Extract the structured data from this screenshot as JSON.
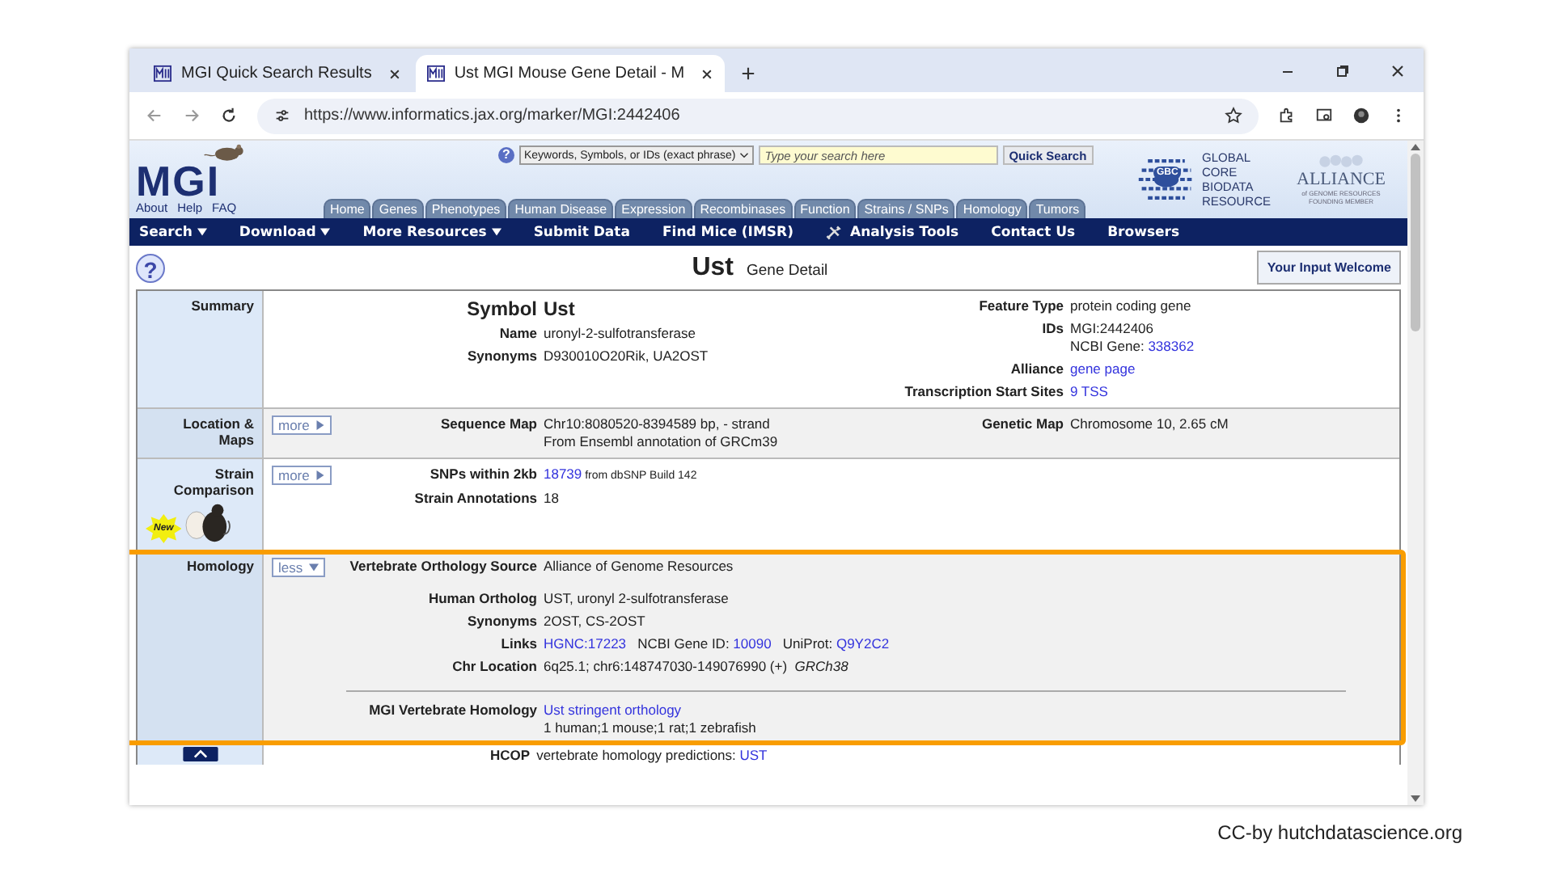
{
  "browser": {
    "tabs": [
      {
        "title": "MGI Quick Search Results",
        "selected": false
      },
      {
        "title": "Ust MGI Mouse Gene Detail - M",
        "selected": true
      }
    ],
    "url": "https://www.informatics.jax.org/marker/MGI:2442406"
  },
  "header": {
    "logo": "MGI",
    "logo_links": [
      "About",
      "Help",
      "FAQ"
    ],
    "help": "?",
    "search_scope": "Keywords, Symbols, or IDs (exact phrase)",
    "search": {
      "placeholder": "Type your search here"
    },
    "search_button": "Quick Search",
    "gcbr_badge": "GBC",
    "gcbr": "GLOBAL CORE BIODATA RESOURCE",
    "alliance": "ALLIANCE",
    "alliance_sub": "of GENOME RESOURCES",
    "alliance_member": "FOUNDING MEMBER",
    "tabs": [
      "Home",
      "Genes",
      "Phenotypes",
      "Human Disease",
      "Expression",
      "Recombinases",
      "Function",
      "Strains / SNPs",
      "Homology",
      "Tumors"
    ]
  },
  "nav": [
    {
      "label": "Search",
      "kind": "menu"
    },
    {
      "label": "Download",
      "kind": "menu"
    },
    {
      "label": "More Resources",
      "kind": "menu"
    },
    {
      "label": "Submit Data",
      "kind": "link"
    },
    {
      "label": "Find Mice (IMSR)",
      "kind": "link"
    },
    {
      "label": "Analysis Tools",
      "kind": "tools"
    },
    {
      "label": "Contact Us",
      "kind": "link"
    },
    {
      "label": "Browsers",
      "kind": "link"
    }
  ],
  "title": {
    "help": "?",
    "symbol": "Ust",
    "subtitle": "Gene Detail",
    "feedback_button": "Your Input Welcome"
  },
  "sections": [
    {
      "label": "Summary",
      "shaded": false,
      "highlighted": false,
      "columns": [
        [
          {
            "fields": [
              {
                "kind": "symbol",
                "label": "Symbol",
                "lines": [
                  [
                    {
                      "text": "Ust"
                    }
                  ]
                ]
              },
              {
                "kind": "field",
                "label": "Name",
                "lines": [
                  [
                    {
                      "text": "uronyl-2-sulfotransferase"
                    }
                  ]
                ]
              },
              {
                "kind": "field",
                "label": "Synonyms",
                "lines": [
                  [
                    {
                      "text": "D930010O20Rik, UA2OST"
                    }
                  ]
                ]
              }
            ]
          }
        ],
        [
          {
            "fields": [
              {
                "kind": "field",
                "label": "Feature Type",
                "lines": [
                  [
                    {
                      "text": "protein coding gene"
                    }
                  ]
                ]
              },
              {
                "kind": "field",
                "label": "IDs",
                "lines": [
                  [
                    {
                      "text": "MGI:2442406"
                    }
                  ],
                  [
                    {
                      "text": "NCBI Gene: "
                    },
                    {
                      "text": "338362",
                      "kind": "link"
                    }
                  ]
                ]
              },
              {
                "kind": "field",
                "label": "Alliance",
                "lines": [
                  [
                    {
                      "text": "gene page",
                      "kind": "link"
                    }
                  ]
                ]
              },
              {
                "kind": "field",
                "label": "Transcription Start Sites",
                "lines": [
                  [
                    {
                      "text": "9 TSS",
                      "kind": "link"
                    }
                  ]
                ]
              }
            ]
          }
        ]
      ]
    },
    {
      "label": "Location & Maps",
      "shaded": true,
      "highlighted": false,
      "expander": {
        "text": "more",
        "expanded": false
      },
      "columns": [
        [
          {
            "fields": [
              {
                "kind": "field",
                "label": "Sequence Map",
                "lines": [
                  [
                    {
                      "text": "Chr10:8080520-8394589 bp, - strand"
                    }
                  ],
                  [
                    {
                      "text": "From Ensembl annotation of GRCm39"
                    }
                  ]
                ]
              }
            ]
          }
        ],
        [
          {
            "fields": [
              {
                "kind": "field",
                "label": "Genetic Map",
                "lines": [
                  [
                    {
                      "text": "Chromosome 10, 2.65 cM"
                    }
                  ]
                ]
              }
            ]
          }
        ]
      ]
    },
    {
      "label": "Strain Comparison",
      "shaded": false,
      "highlighted": false,
      "badge": "New",
      "expander": {
        "text": "more",
        "expanded": false
      },
      "columns": [
        [
          {
            "fields": [
              {
                "kind": "field",
                "label": "SNPs within 2kb",
                "lines": [
                  [
                    {
                      "text": "18739",
                      "kind": "link"
                    },
                    {
                      "text": " from dbSNP Build 142",
                      "kind": "small"
                    }
                  ]
                ]
              },
              {
                "kind": "field",
                "label": "Strain Annotations",
                "lines": [
                  [
                    {
                      "text": "18"
                    }
                  ]
                ]
              }
            ]
          }
        ]
      ]
    },
    {
      "label": "Homology",
      "shaded": true,
      "highlighted": true,
      "expander": {
        "text": "less",
        "expanded": true
      },
      "columns": [
        [
          {
            "fields": [
              {
                "kind": "field",
                "label": "Vertebrate Orthology Source",
                "lines": [
                  [
                    {
                      "text": "Alliance of Genome Resources"
                    }
                  ]
                ]
              }
            ]
          },
          {
            "fields": [
              {
                "kind": "field",
                "label": "Human Ortholog",
                "lines": [
                  [
                    {
                      "text": "UST, uronyl 2-sulfotransferase"
                    }
                  ]
                ]
              },
              {
                "kind": "field",
                "label": "Synonyms",
                "lines": [
                  [
                    {
                      "text": "2OST, CS-2OST"
                    }
                  ]
                ]
              },
              {
                "kind": "field",
                "label": "Links",
                "lines": [
                  [
                    {
                      "text": "HGNC:17223",
                      "kind": "link"
                    },
                    {
                      "text": "   NCBI Gene ID: "
                    },
                    {
                      "text": "10090",
                      "kind": "link"
                    },
                    {
                      "text": "   UniProt: "
                    },
                    {
                      "text": "Q9Y2C2",
                      "kind": "link"
                    }
                  ]
                ]
              },
              {
                "kind": "field",
                "label": "Chr Location",
                "lines": [
                  [
                    {
                      "text": "6q25.1; chr6:148747030-149076990 (+)  "
                    },
                    {
                      "text": "GRCh38",
                      "kind": "italic"
                    }
                  ]
                ]
              }
            ]
          }
        ]
      ],
      "footer": {
        "fields": [
          {
            "label": "MGI Vertebrate Homology",
            "lines": [
              [
                {
                  "text": "Ust stringent orthology",
                  "kind": "link"
                }
              ],
              [
                {
                  "text": "1 human;1 mouse;1 rat;1 zebrafish"
                }
              ]
            ]
          }
        ]
      }
    }
  ],
  "next_row": {
    "label": "HCOP",
    "value": "vertebrate homology predictions: ",
    "link": "UST"
  },
  "credit": "CC-by hutchdatascience.org"
}
